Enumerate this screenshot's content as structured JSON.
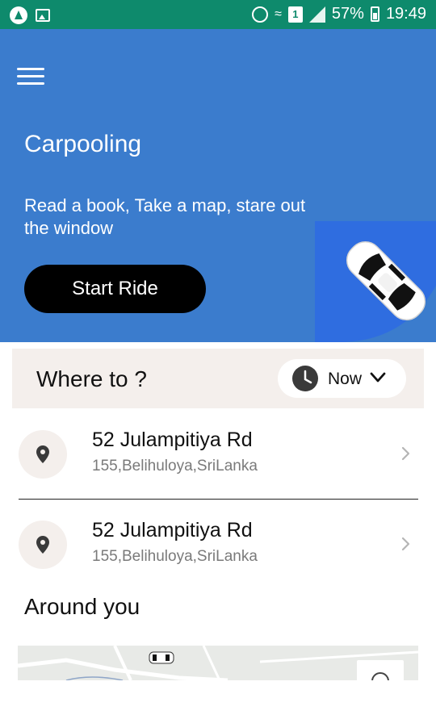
{
  "status_bar": {
    "battery_percent": "57%",
    "time": "19:49",
    "sim_slot": "1"
  },
  "hero": {
    "title": "Carpooling",
    "subtitle": "Read a book, Take a map, stare out the window",
    "start_button_label": "Start Ride",
    "background_color": "#3b7ccd"
  },
  "where_to": {
    "label": "Where to ?",
    "time_option": "Now"
  },
  "recent_locations": [
    {
      "title": "52 Julampitiya Rd",
      "subtitle": "155,Belihuloya,SriLanka"
    },
    {
      "title": "52 Julampitiya Rd",
      "subtitle": "155,Belihuloya,SriLanka"
    }
  ],
  "around_you": {
    "title": "Around you"
  },
  "colors": {
    "status_bar": "#0e8a6c",
    "accent_blue": "#3b7ccd",
    "pill_bg": "#f4efec"
  }
}
